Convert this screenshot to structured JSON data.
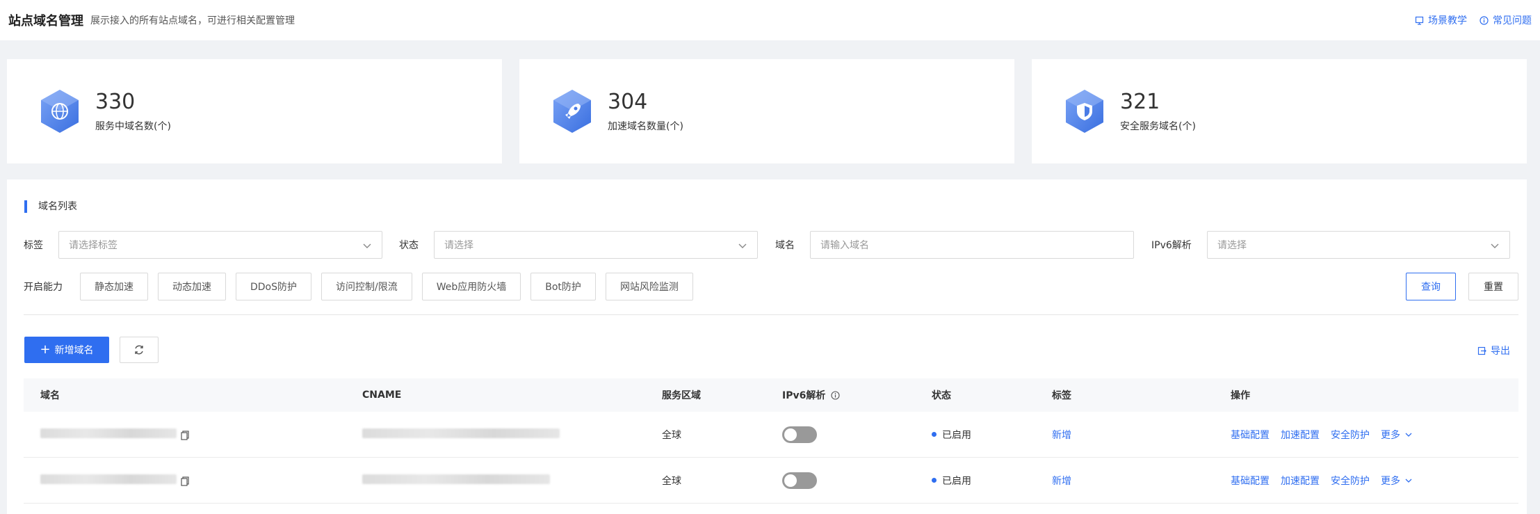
{
  "header": {
    "title": "站点域名管理",
    "subtitle": "展示接入的所有站点域名，可进行相关配置管理",
    "link_tutorial": "场景教学",
    "link_faq": "常见问题"
  },
  "stats": [
    {
      "value": "330",
      "label": "服务中域名数(个)",
      "icon": "globe-icon"
    },
    {
      "value": "304",
      "label": "加速域名数量(个)",
      "icon": "rocket-icon"
    },
    {
      "value": "321",
      "label": "安全服务域名(个)",
      "icon": "shield-icon"
    }
  ],
  "section_title": "域名列表",
  "filters": {
    "tag_label": "标签",
    "tag_placeholder": "请选择标签",
    "status_label": "状态",
    "status_placeholder": "请选择",
    "domain_label": "域名",
    "domain_placeholder": "请输入域名",
    "ipv6_label": "IPv6解析",
    "ipv6_placeholder": "请选择"
  },
  "capabilities": {
    "label": "开启能力",
    "items": [
      "静态加速",
      "动态加速",
      "DDoS防护",
      "访问控制/限流",
      "Web应用防火墙",
      "Bot防护",
      "网站风险监测"
    ]
  },
  "buttons": {
    "query": "查询",
    "reset": "重置",
    "add": "新增域名",
    "export": "导出"
  },
  "table": {
    "headers": [
      "域名",
      "CNAME",
      "服务区域",
      "IPv6解析",
      "状态",
      "标签",
      "操作"
    ],
    "rows": [
      {
        "region": "全球",
        "status": "已启用",
        "tag": "新增",
        "actions": [
          "基础配置",
          "加速配置",
          "安全防护",
          "更多"
        ]
      },
      {
        "region": "全球",
        "status": "已启用",
        "tag": "新增",
        "actions": [
          "基础配置",
          "加速配置",
          "安全防护",
          "更多"
        ]
      }
    ]
  },
  "colors": {
    "accent": "#2f6ef0",
    "toggle_off": "#999999"
  }
}
